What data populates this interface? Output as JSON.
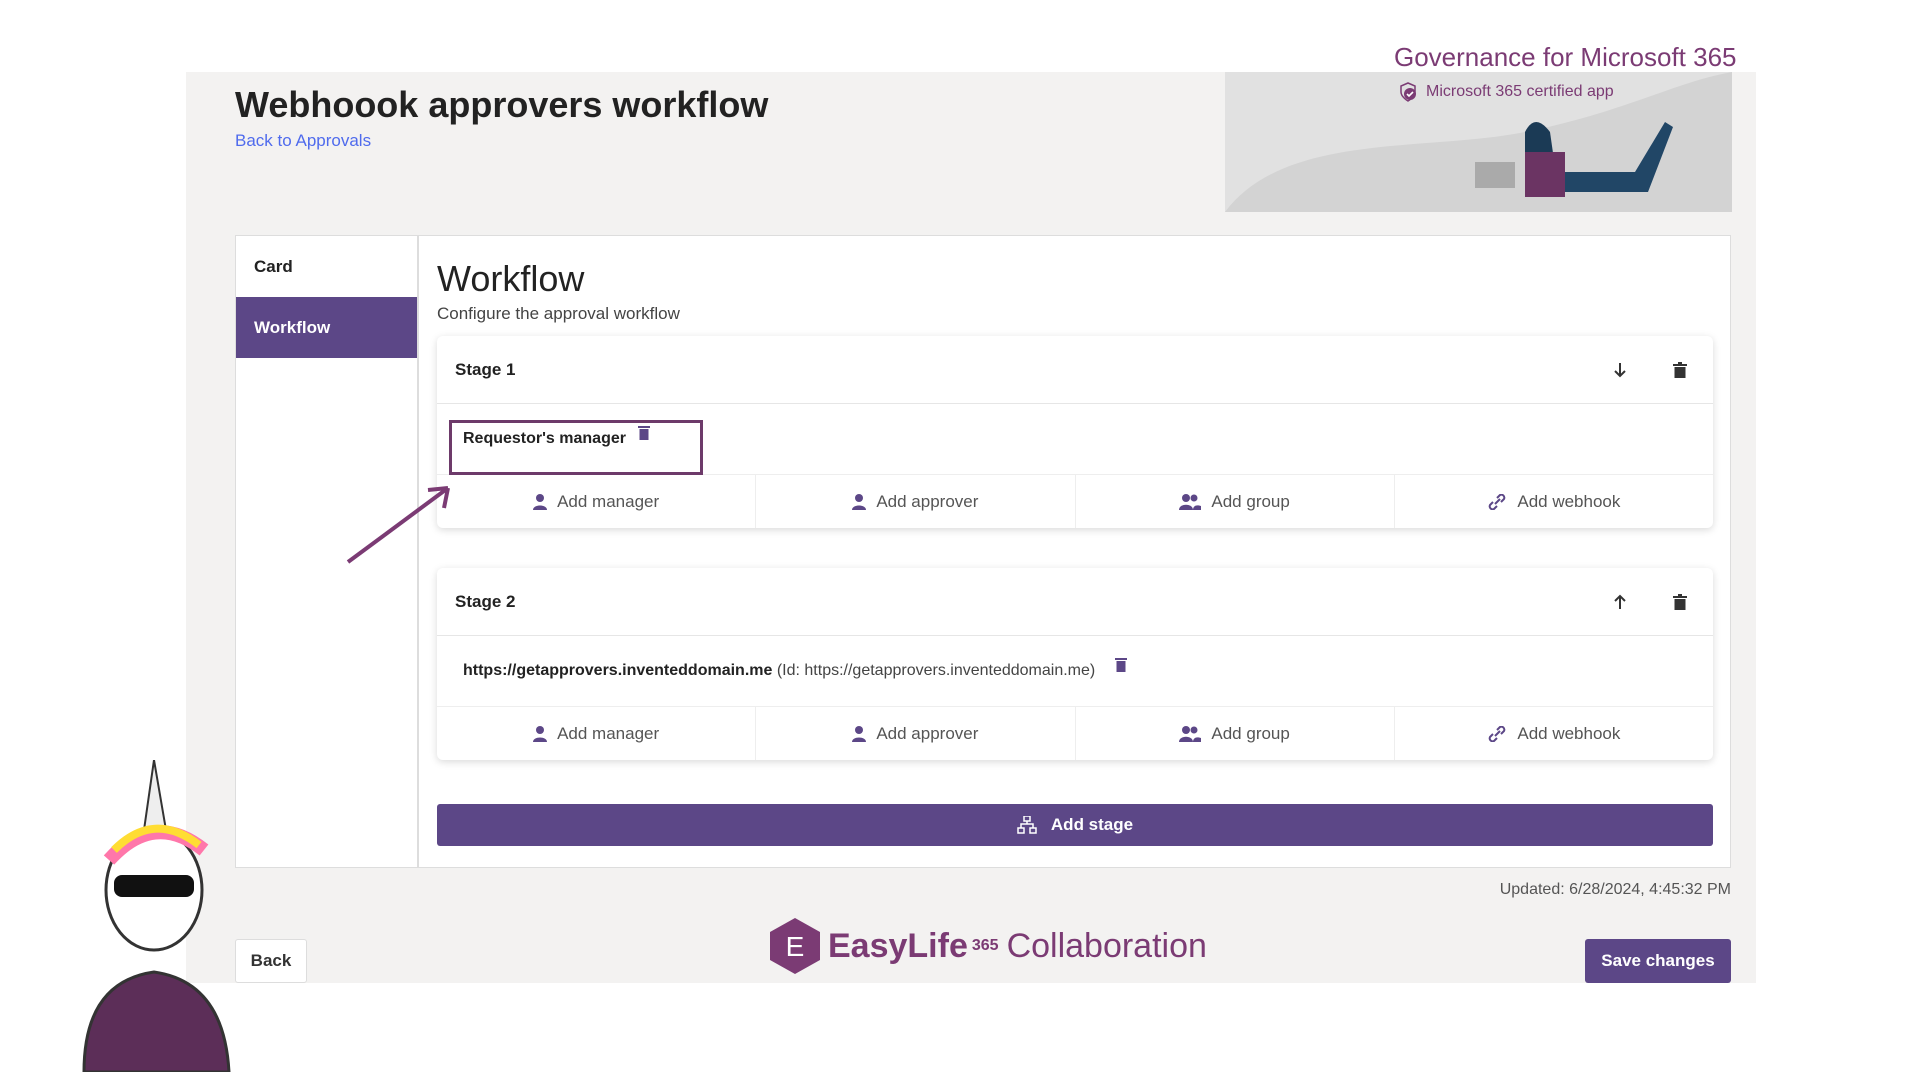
{
  "header": {
    "brand": "Governance for Microsoft 365",
    "certified": "Microsoft 365 certified app",
    "title": "Webhoook approvers workflow",
    "back_link": "Back to Approvals"
  },
  "sidebar": {
    "items": [
      {
        "label": "Card",
        "active": false
      },
      {
        "label": "Workflow",
        "active": true
      }
    ]
  },
  "main": {
    "title": "Workflow",
    "subtitle": "Configure the approval workflow",
    "stages": [
      {
        "label": "Stage 1",
        "move_icon": "arrow-down-icon",
        "approver_name": "Requestor's manager",
        "approver_id": ""
      },
      {
        "label": "Stage 2",
        "move_icon": "arrow-up-icon",
        "approver_name": "https://getapprovers.inventeddomain.me",
        "approver_id": "(Id: https://getapprovers.inventeddomain.me)"
      }
    ],
    "actions": {
      "add_manager": "Add manager",
      "add_approver": "Add approver",
      "add_group": "Add group",
      "add_webhook": "Add webhook"
    },
    "add_stage": "Add stage"
  },
  "footer": {
    "updated": "Updated: 6/28/2024, 4:45:32 PM",
    "back": "Back",
    "save": "Save changes",
    "logo_main": "EasyLife",
    "logo_sup": "365",
    "logo_sub": "Collaboration",
    "logo_letter": "E"
  },
  "colors": {
    "accent": "#5c4787",
    "brand": "#7b3b74"
  }
}
